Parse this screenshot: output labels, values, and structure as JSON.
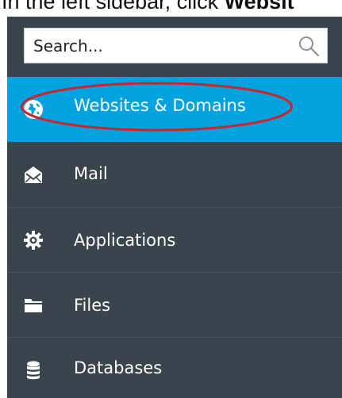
{
  "caption": {
    "prefix": "In the left sidebar, click ",
    "bold": "Websit"
  },
  "search": {
    "placeholder": "Search..."
  },
  "sidebar": {
    "items": [
      {
        "label": "Websites & Domains",
        "icon": "globe-icon",
        "active": true
      },
      {
        "label": "Mail",
        "icon": "envelope-icon",
        "active": false
      },
      {
        "label": "Applications",
        "icon": "gear-icon",
        "active": false
      },
      {
        "label": "Files",
        "icon": "folder-icon",
        "active": false
      },
      {
        "label": "Databases",
        "icon": "database-icon",
        "active": false
      }
    ]
  },
  "colors": {
    "sidebar_bg": "#3b434c",
    "active_bg": "#00a3df",
    "highlight": "#c8282d"
  }
}
